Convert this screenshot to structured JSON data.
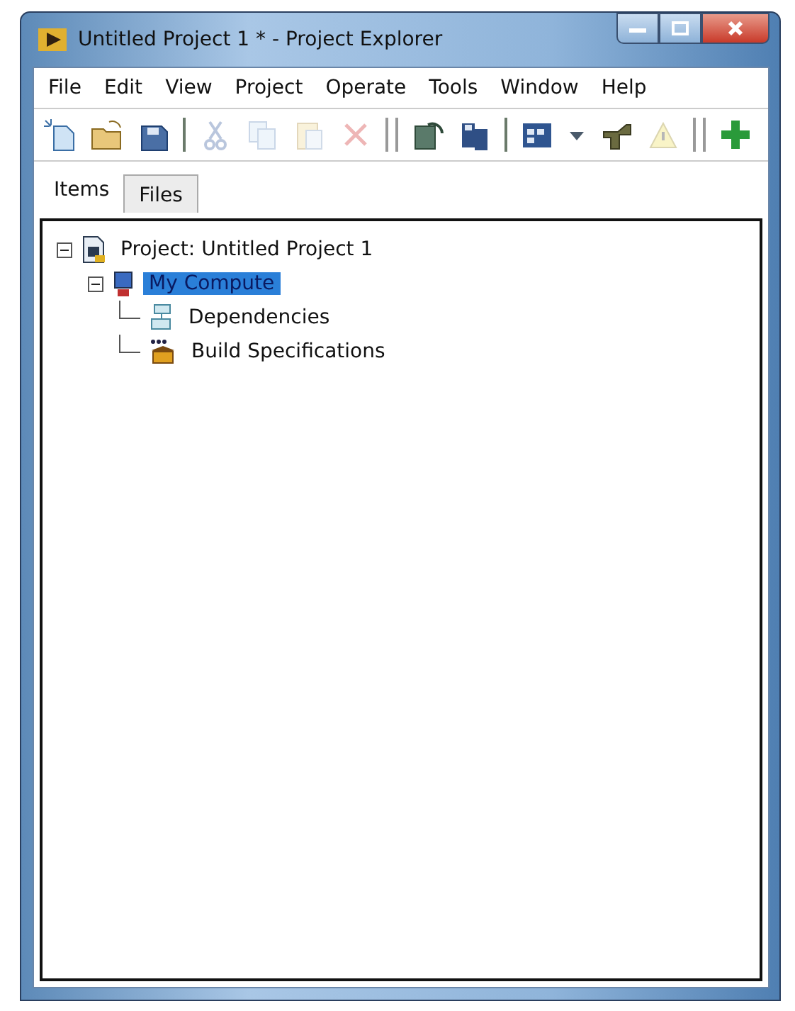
{
  "window": {
    "title": "Untitled Project 1 * - Project Explorer"
  },
  "menu": [
    "File",
    "Edit",
    "View",
    "Project",
    "Operate",
    "Tools",
    "Window",
    "Help"
  ],
  "toolbar": [
    {
      "kind": "new",
      "disabled": false
    },
    {
      "kind": "open",
      "disabled": false
    },
    {
      "kind": "save",
      "disabled": false
    },
    {
      "kind": "sep"
    },
    {
      "kind": "cut",
      "disabled": true
    },
    {
      "kind": "copy",
      "disabled": true
    },
    {
      "kind": "paste",
      "disabled": true
    },
    {
      "kind": "delete",
      "disabled": true
    },
    {
      "kind": "grip"
    },
    {
      "kind": "refresh",
      "disabled": false
    },
    {
      "kind": "saveall",
      "disabled": false
    },
    {
      "kind": "sep"
    },
    {
      "kind": "grid",
      "disabled": false
    },
    {
      "kind": "dropdown",
      "disabled": false
    },
    {
      "kind": "hand",
      "disabled": false
    },
    {
      "kind": "warning",
      "disabled": true
    },
    {
      "kind": "grip"
    },
    {
      "kind": "add",
      "disabled": false
    }
  ],
  "tabs": [
    {
      "label": "Items",
      "selected": true
    },
    {
      "label": "Files",
      "selected": false
    }
  ],
  "tree": [
    {
      "label": "Project: Untitled Project 1",
      "kind": "project",
      "selected": false,
      "expanded": true,
      "children": [
        {
          "label": "My Compute",
          "kind": "computer",
          "selected": true,
          "expanded": true,
          "children": [
            {
              "label": "Dependencies",
              "kind": "dependencies",
              "selected": false
            },
            {
              "label": "Build Specifications",
              "kind": "build",
              "selected": false
            }
          ]
        }
      ]
    }
  ]
}
